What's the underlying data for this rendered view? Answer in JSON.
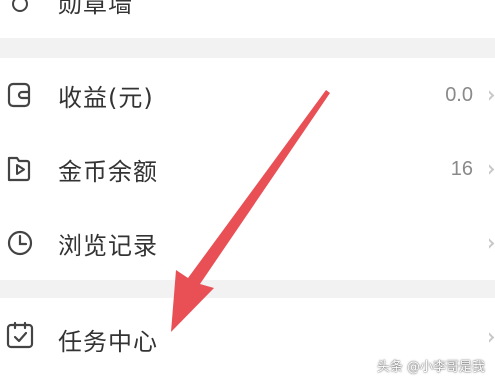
{
  "menu": {
    "top_partial": {
      "label": "勋章墙",
      "icon": "medal-icon"
    },
    "items": [
      {
        "label": "收益(元)",
        "value": "0.0",
        "icon": "wallet-icon"
      },
      {
        "label": "金币余额",
        "value": "16",
        "icon": "play-coin-icon"
      },
      {
        "label": "浏览记录",
        "value": "",
        "icon": "clock-icon"
      },
      {
        "label": "任务中心",
        "value": "",
        "icon": "task-clipboard-icon"
      }
    ]
  },
  "annotation": {
    "arrow_color": "#e8474c",
    "icon": "red-arrow"
  },
  "watermark": "头条 @小李哥是我",
  "colors": {
    "divider": "#f2f2f2",
    "text": "#333333",
    "value": "#8a8a8a"
  }
}
